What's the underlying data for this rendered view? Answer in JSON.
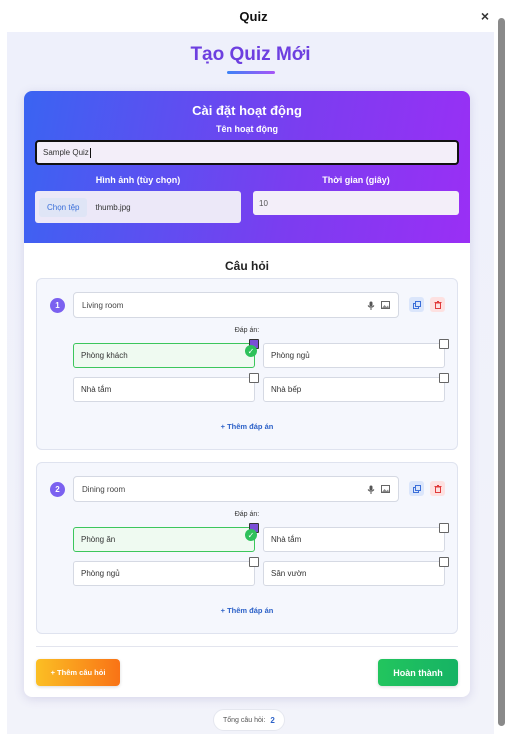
{
  "window": {
    "title": "Quiz",
    "close_glyph": "×"
  },
  "page": {
    "title": "Tạo Quiz Mới"
  },
  "settings": {
    "heading": "Cài đặt hoạt động",
    "name_label": "Tên hoạt động",
    "name_value": "Sample Quiz",
    "image_label": "Hình ảnh (tùy chọn)",
    "file_button": "Chọn tệp",
    "file_name": "thumb.jpg",
    "time_label": "Thời gian (giây)",
    "time_value": "10"
  },
  "questions_heading": "Câu hỏi",
  "questions": [
    {
      "number": "1",
      "text": "Living room",
      "answers_label": "Đáp án:",
      "answers": [
        "Phòng khách",
        "Phòng ngủ",
        "Nhà tắm",
        "Nhà bếp"
      ],
      "correct_index": 0,
      "add_answer": "+ Thêm đáp án"
    },
    {
      "number": "2",
      "text": "Dining room",
      "answers_label": "Đáp án:",
      "answers": [
        "Phòng ăn",
        "Nhà tắm",
        "Phòng ngủ",
        "Sân vườn"
      ],
      "correct_index": 0,
      "add_answer": "+ Thêm đáp án"
    }
  ],
  "footer": {
    "add_question": "+ Thêm câu hỏi",
    "done": "Hoàn thành",
    "total_label": "Tổng câu hỏi:",
    "total_value": "2"
  },
  "icons": {
    "mic": "microphone-icon",
    "image": "image-icon",
    "copy": "copy-icon",
    "delete": "trash-icon",
    "check": "check-icon"
  },
  "colors": {
    "accent": "#6d3fe0",
    "correct": "#3cc65c",
    "link": "#2d62c8"
  }
}
